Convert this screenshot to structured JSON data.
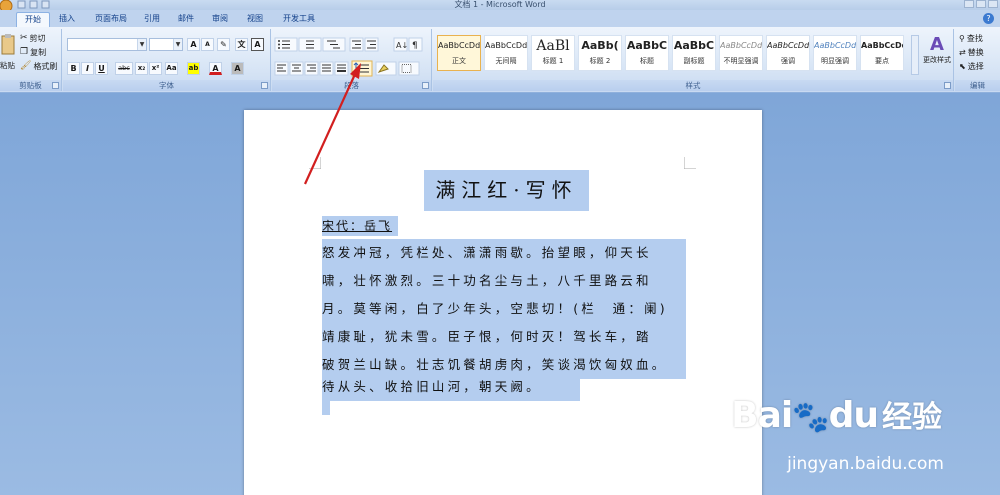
{
  "window": {
    "title": "文档 1 - Microsoft Word"
  },
  "tabs": [
    "开始",
    "插入",
    "页面布局",
    "引用",
    "邮件",
    "审阅",
    "视图",
    "开发工具"
  ],
  "clipboard": {
    "paste": "粘贴",
    "cut": "剪切",
    "copy": "复制",
    "format_painter": "格式刷",
    "group": "剪贴板"
  },
  "font": {
    "group": "字体",
    "bold": "B",
    "italic": "I",
    "underline": "U",
    "strike": "abc",
    "subscript": "x₂",
    "superscript": "x²",
    "change_case": "Aa",
    "grow": "A",
    "shrink": "A",
    "clear": "✎",
    "phonetic": "文",
    "highlight": "ab",
    "font_color": "A",
    "char_border": "A"
  },
  "paragraph": {
    "group": "段落"
  },
  "styles": {
    "group": "样式",
    "items": [
      {
        "sample": "AaBbCcDd",
        "name": "正文",
        "selected": true
      },
      {
        "sample": "AaBbCcDd",
        "name": "无间隔"
      },
      {
        "sample": "AaBl",
        "name": "标题 1"
      },
      {
        "sample": "AaBb(",
        "name": "标题 2"
      },
      {
        "sample": "AaBbC",
        "name": "标题"
      },
      {
        "sample": "AaBbC",
        "name": "副标题"
      },
      {
        "sample": "AaBbCcDd",
        "name": "不明显强调"
      },
      {
        "sample": "AaBbCcDd",
        "name": "强调"
      },
      {
        "sample": "AaBbCcDd",
        "name": "明显强调"
      },
      {
        "sample": "AaBbCcDd",
        "name": "要点"
      }
    ],
    "change_styles": "更改样式"
  },
  "editing": {
    "group": "编辑",
    "find": "查找",
    "replace": "替换",
    "select": "选择"
  },
  "document": {
    "title": "满江红·写怀",
    "byline": "宋代：岳飞",
    "lines": [
      "怒发冲冠，凭栏处、潇潇雨歇。抬望眼，仰天长",
      "啸，壮怀激烈。三十功名尘与土，八千里路云和",
      "月。莫等闲，白了少年头，空悲切！(栏　通：阑)",
      "靖康耻，犹未雪。臣子恨，何时灭！驾长车，踏",
      "破贺兰山缺。壮志饥餐胡虏肉，笑谈渴饮匈奴血。",
      "待从头、收拾旧山河，朝天阙。"
    ]
  },
  "watermark": {
    "logo": "Bai",
    "logo2": "du",
    "sub": "经验",
    "url": "jingyan.baidu.com"
  },
  "colors": {
    "selection": "#b4cdef",
    "arrow": "#d21f1f",
    "ribbon_bg": "#dbe6f6"
  }
}
